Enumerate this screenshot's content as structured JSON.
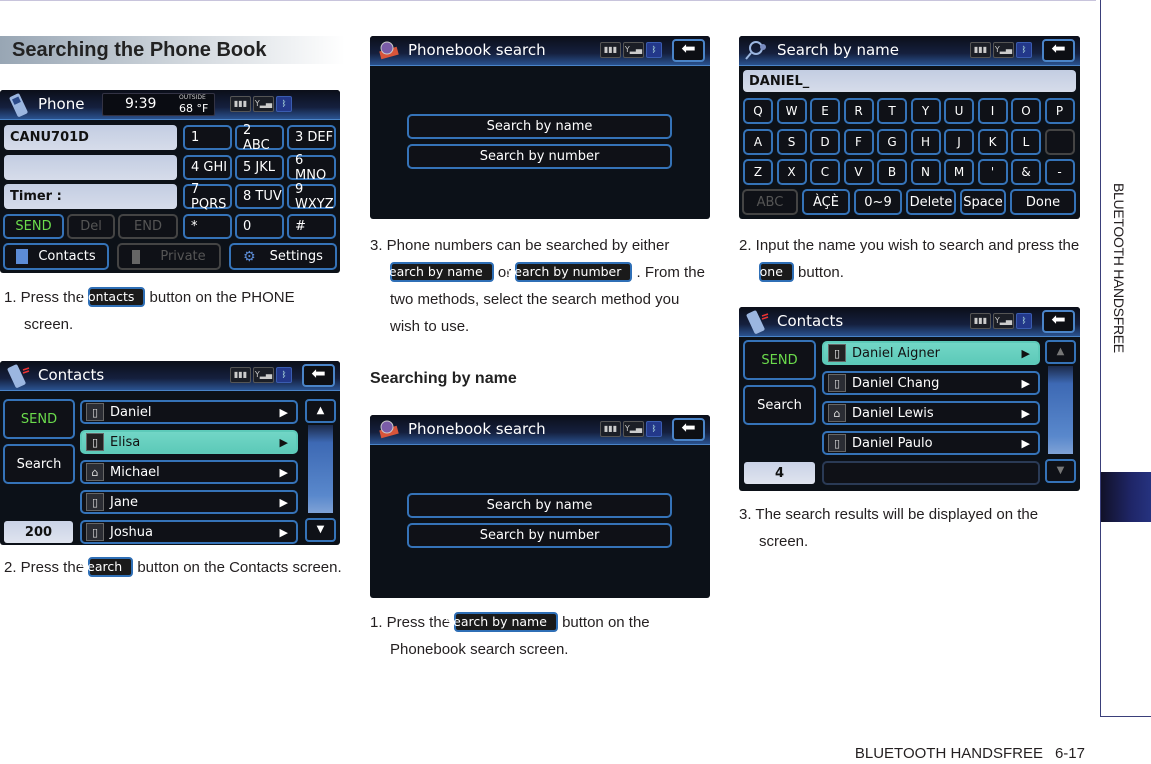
{
  "page": {
    "section_title": "Searching the Phone Book",
    "side_tab_label": "BLUETOOTH HANDSFREE",
    "footer_label": "BLUETOOTH HANDSFREE",
    "page_number": "6-17",
    "sub_title": "Searching by name"
  },
  "phone_screen": {
    "title": "Phone",
    "time": "9:39",
    "outside_label": "OUTSIDE",
    "temperature": "68 °F",
    "field1": "CANU701D",
    "field2": "",
    "field3": "Timer :",
    "keys": [
      "1",
      "2 ABC",
      "3 DEF",
      "4 GHI",
      "5 JKL",
      "6 MNO",
      "7 PQRS",
      "8 TUV",
      "9 WXYZ",
      "*",
      "0",
      "#"
    ],
    "send": "SEND",
    "del": "Del",
    "end": "END",
    "contacts": "Contacts",
    "private": "Private",
    "settings": "Settings"
  },
  "contacts_screen_1": {
    "title": "Contacts",
    "send": "SEND",
    "search": "Search",
    "count": "200",
    "rows": [
      {
        "name": "Daniel",
        "icon": "office-phone",
        "selected": false
      },
      {
        "name": "Elisa",
        "icon": "mobile-phone",
        "selected": true
      },
      {
        "name": "Michael",
        "icon": "home-phone",
        "selected": false
      },
      {
        "name": "Jane",
        "icon": "mobile-phone",
        "selected": false
      },
      {
        "name": "Joshua",
        "icon": "office-phone",
        "selected": false
      }
    ]
  },
  "phonebook_search_1": {
    "title": "Phonebook search",
    "by_name": "Search by name",
    "by_number": "Search by number"
  },
  "phonebook_search_2": {
    "title": "Phonebook search",
    "by_name": "Search by name",
    "by_number": "Search by number"
  },
  "search_by_name_screen": {
    "title": "Search by name",
    "input_value": "DANIEL_",
    "rows": [
      [
        "Q",
        "W",
        "E",
        "R",
        "T",
        "Y",
        "U",
        "I",
        "O",
        "P"
      ],
      [
        "A",
        "S",
        "D",
        "F",
        "G",
        "H",
        "J",
        "K",
        "L",
        ""
      ],
      [
        "Z",
        "X",
        "C",
        "V",
        "B",
        "N",
        "M",
        "'",
        "&",
        "-"
      ]
    ],
    "bottom": {
      "abc": "ABC",
      "accents": "ÀÇÈ",
      "digits": "0~9",
      "delete": "Delete",
      "space": "Space",
      "done": "Done"
    }
  },
  "contacts_screen_2": {
    "title": "Contacts",
    "send": "SEND",
    "search": "Search",
    "count": "4",
    "rows": [
      {
        "name": "Daniel Aigner",
        "icon": "mobile-phone",
        "selected": true
      },
      {
        "name": "Daniel Chang",
        "icon": "office-phone",
        "selected": false
      },
      {
        "name": "Daniel Lewis",
        "icon": "home-phone",
        "selected": false
      },
      {
        "name": "Daniel Paulo",
        "icon": "mobile-phone",
        "selected": false
      },
      {
        "name": "",
        "icon": "",
        "selected": false
      }
    ]
  },
  "steps": {
    "s1_prefix": "1. Press the ",
    "s1_pill": "Contacts",
    "s1_suffix": " button on the PHONE screen.",
    "s2_prefix": "2. Press the ",
    "s2_pill": "Search",
    "s2_suffix": " button on the Contacts screen.",
    "s3_prefix": "3. Phone numbers can be searched by either ",
    "s3_pill1": "Search by name",
    "s3_mid": " or ",
    "s3_pill2": "Search by number",
    "s3_suffix": " . From the two methods, select the search method you wish to use.",
    "n1_prefix": "1. Press the ",
    "n1_pill": "Search by name",
    "n1_suffix": " button on the Phonebook search screen.",
    "n2_prefix": "2. Input the name you wish to search and press the ",
    "n2_pill": "Done",
    "n2_suffix": " button.",
    "n3_text": "3. The search results will be displayed on the screen."
  },
  "status_icons": [
    "battery-icon",
    "signal-icon",
    "bluetooth-icon"
  ]
}
